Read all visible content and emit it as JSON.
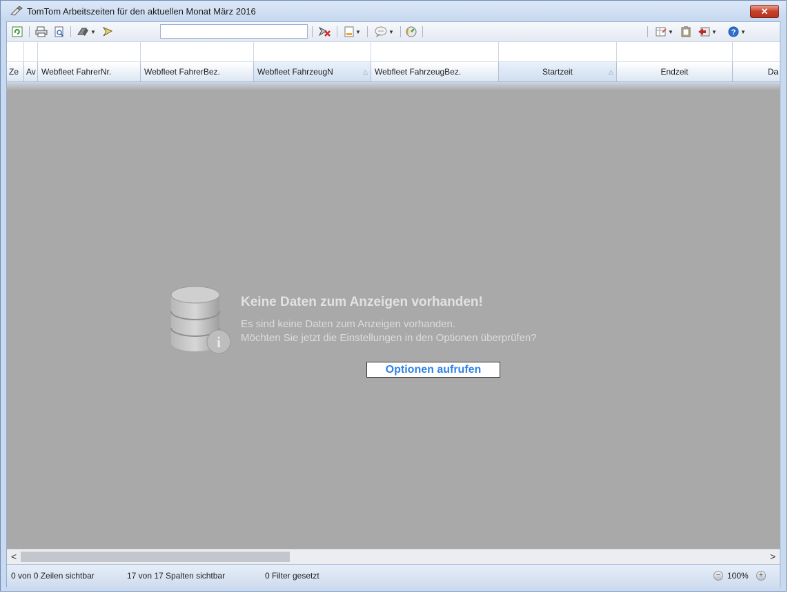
{
  "window": {
    "title": "TomTom Arbeitszeiten für den aktuellen Monat März 2016",
    "close_label": "✕"
  },
  "toolbar": {
    "search_value": "",
    "search_placeholder": ""
  },
  "columns": [
    {
      "label": "Ze",
      "sorted": false
    },
    {
      "label": "Av",
      "sorted": false
    },
    {
      "label": "Webfleet FahrerNr.",
      "sorted": false
    },
    {
      "label": "Webfleet FahrerBez.",
      "sorted": false
    },
    {
      "label": "Webfleet FahrzeugN",
      "sorted": true
    },
    {
      "label": "Webfleet FahrzeugBez.",
      "sorted": false
    },
    {
      "label": "Startzeit",
      "sorted": true
    },
    {
      "label": "Endzeit",
      "sorted": false
    },
    {
      "label": "Da",
      "sorted": false
    }
  ],
  "empty_state": {
    "title": "Keine Daten zum Anzeigen vorhanden!",
    "line1": "Es sind keine Daten zum Anzeigen vorhanden.",
    "line2": "Möchten Sie jetzt die Einstellungen in den Optionen überprüfen?",
    "button": "Optionen aufrufen"
  },
  "scrollbar": {
    "left_arrow": "<",
    "right_arrow": ">"
  },
  "status": {
    "rows": "0 von 0 Zeilen sichtbar",
    "columns": "17 von 17 Spalten sichtbar",
    "filters": "0 Filter gesetzt",
    "zoom": "100%"
  },
  "icons": {
    "title": "pen-book-icon",
    "refresh": "refresh-icon",
    "print": "print-icon",
    "preview": "print-preview-icon",
    "export": "export-icon",
    "filter": "filter-icon",
    "clear_filter": "clear-filter-icon",
    "document": "document-icon",
    "comment": "comment-icon",
    "gauge": "gauge-icon",
    "layout": "layout-icon",
    "clipboard": "clipboard-icon",
    "exit": "exit-icon",
    "help": "help-icon"
  }
}
